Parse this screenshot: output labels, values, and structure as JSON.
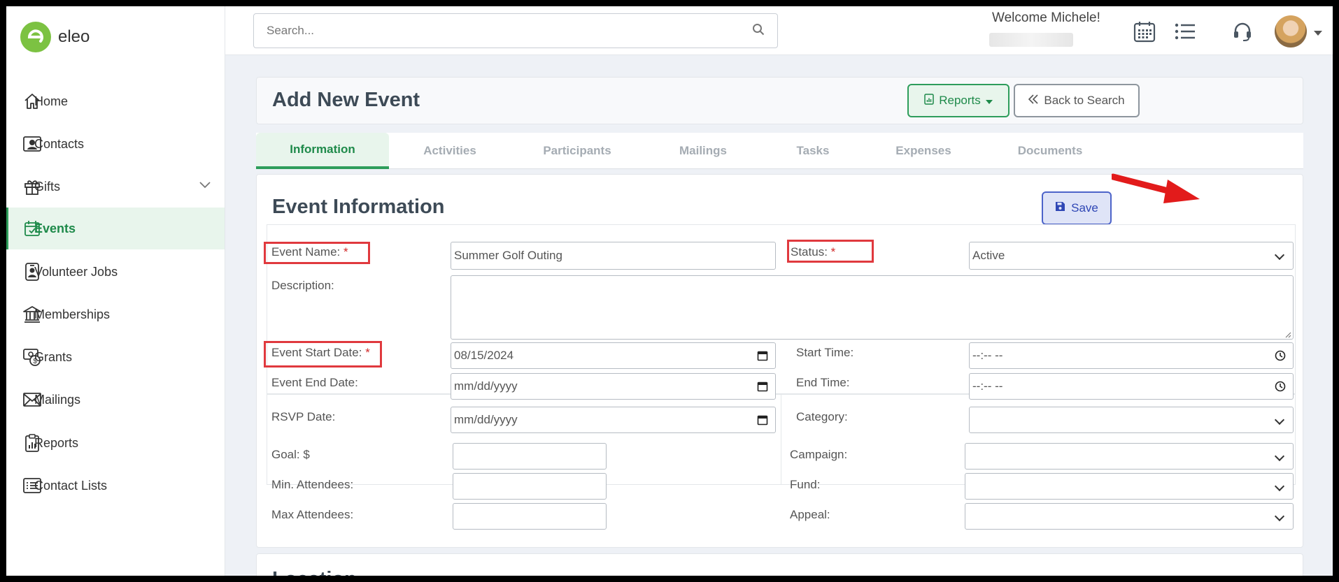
{
  "brand": {
    "name": "eleo",
    "color": "#7cc242"
  },
  "sidebar": {
    "items": [
      {
        "label": "Home",
        "icon": "home-icon"
      },
      {
        "label": "Contacts",
        "icon": "contact-card-icon"
      },
      {
        "label": "Gifts",
        "icon": "gift-icon",
        "has_submenu": true
      },
      {
        "label": "Events",
        "icon": "calendar-check-icon",
        "active": true
      },
      {
        "label": "Volunteer Jobs",
        "icon": "id-badge-icon"
      },
      {
        "label": "Memberships",
        "icon": "institution-icon"
      },
      {
        "label": "Grants",
        "icon": "grant-money-icon"
      },
      {
        "label": "Mailings",
        "icon": "envelope-icon"
      },
      {
        "label": "Reports",
        "icon": "clipboard-chart-icon"
      },
      {
        "label": "Contact Lists",
        "icon": "list-icon"
      }
    ]
  },
  "topbar": {
    "search_placeholder": "Search...",
    "welcome": "Welcome Michele!"
  },
  "header": {
    "title": "Add New Event",
    "reports_label": "Reports",
    "back_label": "Back to Search"
  },
  "tabs": [
    {
      "label": "Information",
      "active": true
    },
    {
      "label": "Activities"
    },
    {
      "label": "Participants"
    },
    {
      "label": "Mailings"
    },
    {
      "label": "Tasks"
    },
    {
      "label": "Expenses"
    },
    {
      "label": "Documents"
    }
  ],
  "form": {
    "section_title": "Event Information",
    "save_label": "Save",
    "event_name": {
      "label": "Event Name:",
      "value": "Summer Golf Outing"
    },
    "status": {
      "label": "Status:",
      "value": "Active"
    },
    "description": {
      "label": "Description:",
      "value": ""
    },
    "event_start_date": {
      "label": "Event Start Date:",
      "value": "08/15/2024"
    },
    "start_time": {
      "label": "Start Time:",
      "value": "--:-- --"
    },
    "event_end_date": {
      "label": "Event End Date:",
      "value": "mm/dd/yyyy"
    },
    "end_time": {
      "label": "End Time:",
      "value": "--:-- --"
    },
    "rsvp_date": {
      "label": "RSVP Date:",
      "value": "mm/dd/yyyy"
    },
    "category": {
      "label": "Category:",
      "value": ""
    },
    "goal": {
      "label": "Goal: $",
      "value": ""
    },
    "min_attendees": {
      "label": "Min. Attendees:",
      "value": ""
    },
    "max_attendees": {
      "label": "Max Attendees:",
      "value": ""
    },
    "campaign": {
      "label": "Campaign:",
      "value": ""
    },
    "fund": {
      "label": "Fund:",
      "value": ""
    },
    "appeal": {
      "label": "Appeal:",
      "value": ""
    },
    "required_mark": "*"
  },
  "location": {
    "title": "Location"
  },
  "colors": {
    "accent": "#2e9d5b",
    "save": "#4d64c9",
    "highlight": "#e0393e",
    "arrow": "#e21b1b"
  }
}
